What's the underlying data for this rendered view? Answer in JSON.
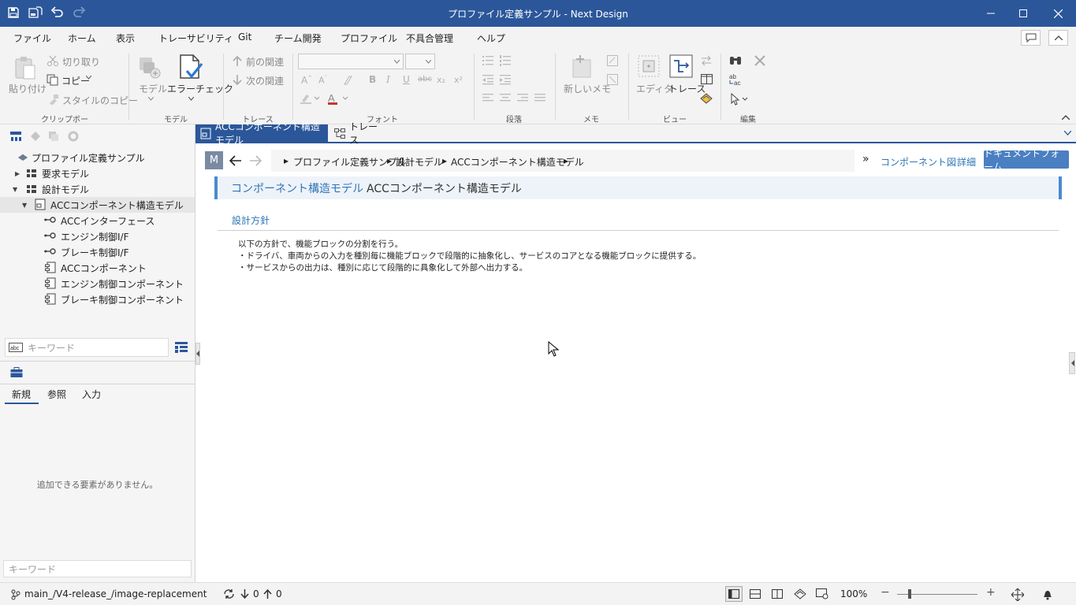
{
  "window": {
    "title": "プロファイル定義サンプル - Next Design"
  },
  "menu": [
    "ファイル",
    "ホーム",
    "表示",
    "トレーサビリティ",
    "Git",
    "チーム開発",
    "プロファイル",
    "不具合管理",
    "ヘルプ"
  ],
  "ribbon": {
    "paste": "貼り付け",
    "cut": "切り取り",
    "copy": "コピー",
    "style_copy": "スタイルのコピー",
    "group_clipboard": "クリップボード",
    "model": "モデル",
    "error_check": "エラーチェック",
    "group_model": "モデル",
    "prev_relation": "前の関連",
    "next_relation": "次の関連",
    "group_trace": "トレース",
    "group_font": "フォント",
    "group_paragraph": "段落",
    "new_memo": "新しいメモ",
    "group_memo": "メモ",
    "editor": "エディタ",
    "trace": "トレース",
    "group_view": "ビュー",
    "group_edit": "編集",
    "bold": "B",
    "italic": "I",
    "underline": "U",
    "strike": "abc",
    "sub": "x₂",
    "sup": "x²"
  },
  "tree": {
    "root": "プロファイル定義サンプル",
    "items": [
      "要求モデル",
      "設計モデル",
      "ACCコンポーネント構造モデル",
      "ACCインターフェース",
      "エンジン制御I/F",
      "ブレーキ制御I/F",
      "ACCコンポーネント",
      "エンジン制御コンポーネント",
      "ブレーキ制御コンポーネント"
    ],
    "search_placeholder": "キーワード"
  },
  "palette": {
    "tabs": [
      "新規",
      "参照",
      "入力"
    ],
    "empty": "追加できる要素がありません。",
    "search_placeholder": "キーワード"
  },
  "doc_tabs": [
    "ACCコンポーネント構造モデル",
    "トレース"
  ],
  "nav": {
    "model_badge": "M",
    "crumbs": [
      "プロファイル定義サンプル",
      "設計モデル",
      "ACCコンポーネント構造モデル"
    ],
    "overflow": "»",
    "views": [
      "コンポーネント図",
      "詳細",
      "ドキュメントフォーム"
    ]
  },
  "document": {
    "header_type": "コンポーネント構造モデル",
    "header_name": "ACCコンポーネント構造モデル",
    "section_title": "設計方針",
    "lines": [
      "以下の方針で、機能ブロックの分割を行う。",
      "・ドライバ、車両からの入力を種別毎に機能ブロックで段階的に抽象化し、サービスのコアとなる機能ブロックに提供する。",
      "・サービスからの出力は、種別に応じて段階的に具象化して外部へ出力する。"
    ]
  },
  "status": {
    "branch": "main_/V4-release_/image-replacement",
    "incoming": "0",
    "outgoing": "0",
    "zoom": "100%",
    "zoom_level": 0.5
  },
  "colors": {
    "accent": "#2b579a",
    "link": "#2e75b6",
    "header_bar": "#4a8ad0"
  }
}
